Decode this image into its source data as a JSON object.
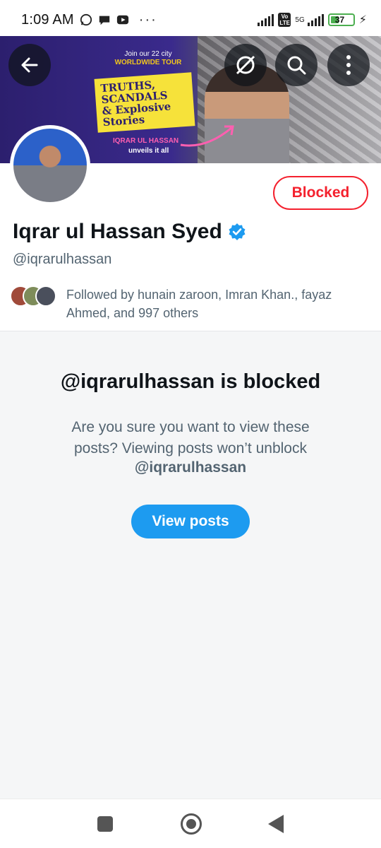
{
  "status_bar": {
    "time": "1:09 AM",
    "dots": "···",
    "net_badge": "Vo LTE",
    "net_type": "5G",
    "battery": "37",
    "battery_level": 0.37
  },
  "banner": {
    "tour_line": "Join our 22 city",
    "tour_sub": "WORLDWIDE TOUR",
    "card_lines": [
      "TRUTHS,",
      "SCANDALS",
      "& Explosive",
      "Stories"
    ],
    "name_line": "IQRAR UL HASSAN",
    "tagline": "unveils it all"
  },
  "header": {
    "back_icon": "arrow-left-icon",
    "grok_icon": "slash-circle-icon",
    "search_icon": "search-icon",
    "more_icon": "more-vertical-icon"
  },
  "profile": {
    "display_name": "Iqrar ul Hassan Syed",
    "handle": "@iqrarulhassan",
    "blocked_label": "Blocked",
    "followed_by": "Followed by hunain zaroon, Imran Khan., fayaz Ahmed, and 997 others"
  },
  "blocked_notice": {
    "title": "@iqrarulhassan is blocked",
    "description": "Are you sure you want to view these posts? Viewing posts won’t unblock",
    "handle": "@iqrarulhassan",
    "view_posts_label": "View posts"
  },
  "colors": {
    "accent": "#1d9bf0",
    "blocked": "#f4212e",
    "verified": "#1d9bf0"
  }
}
